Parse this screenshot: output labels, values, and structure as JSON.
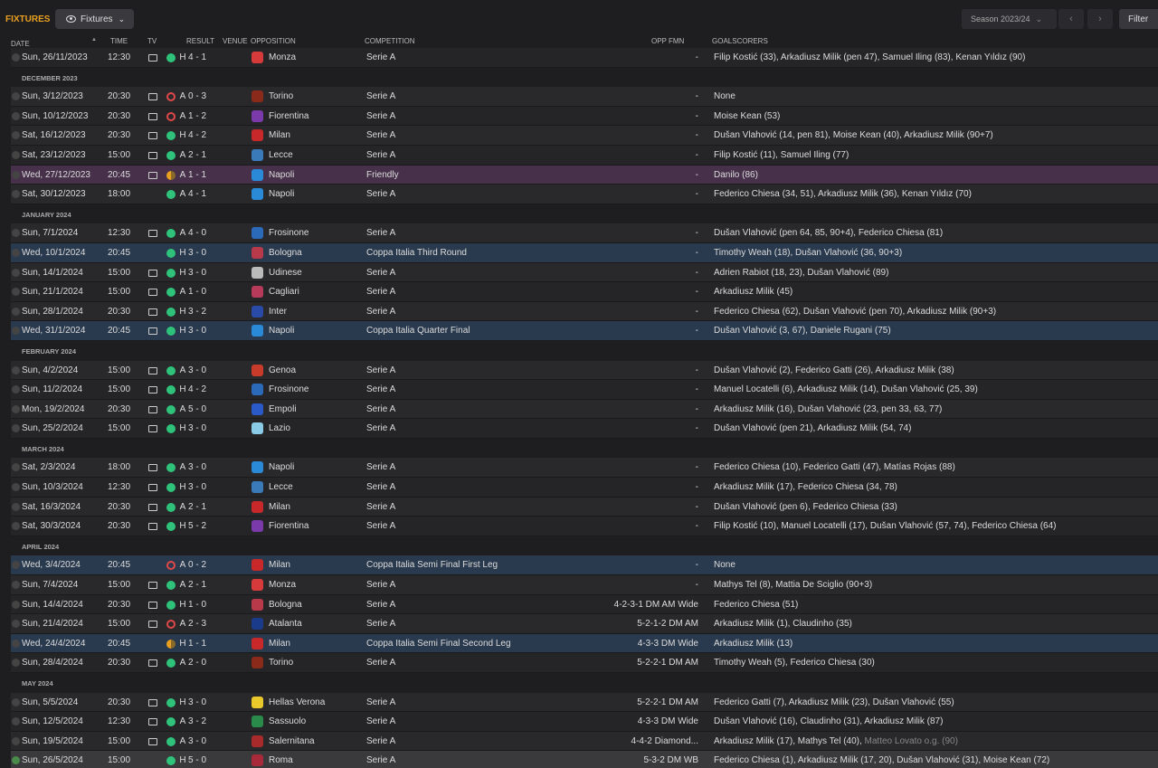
{
  "header": {
    "title": "FIXTURES",
    "view_label": "Fixtures",
    "season": "Season 2023/24",
    "filter": "Filter",
    "prev": "‹",
    "next": "›"
  },
  "columns": {
    "date": "DATE",
    "time": "TIME",
    "tv": "TV",
    "result": "RESULT",
    "venue": "VENUE",
    "opposition": "OPPOSITION",
    "competition": "COMPETITION",
    "opp_fmn": "OPP FMN",
    "goalscorers": "GOALSCORERS"
  },
  "rows": [
    {
      "type": "match",
      "date": "Sun, 26/11/2023",
      "time": "12:30",
      "tv": true,
      "outcome": "win",
      "score": "4 - 1",
      "venue": "H",
      "opp": "Monza",
      "crest": "#d63a3a",
      "comp": "Serie A",
      "fmn": "-",
      "goals": "Filip Kostić (33), Arkadiusz Milik (pen 47), Samuel Iling (83), Kenan Yıldız (90)",
      "style": "alt"
    },
    {
      "type": "section",
      "label": "DECEMBER 2023"
    },
    {
      "type": "match",
      "date": "Sun, 3/12/2023",
      "time": "20:30",
      "tv": true,
      "outcome": "loss",
      "score": "0 - 3",
      "venue": "A",
      "opp": "Torino",
      "crest": "#8a2a1a",
      "comp": "Serie A",
      "fmn": "-",
      "goals": "None",
      "style": ""
    },
    {
      "type": "match",
      "date": "Sun, 10/12/2023",
      "time": "20:30",
      "tv": true,
      "outcome": "loss",
      "score": "1 - 2",
      "venue": "A",
      "opp": "Fiorentina",
      "crest": "#7a3aaa",
      "comp": "Serie A",
      "fmn": "-",
      "goals": "Moise Kean (53)",
      "style": "alt"
    },
    {
      "type": "match",
      "date": "Sat, 16/12/2023",
      "time": "20:30",
      "tv": true,
      "outcome": "win",
      "score": "4 - 2",
      "venue": "H",
      "opp": "Milan",
      "crest": "#c8282a",
      "comp": "Serie A",
      "fmn": "-",
      "goals": "Dušan Vlahović (14, pen 81), Moise Kean (40), Arkadiusz Milik (90+7)",
      "style": ""
    },
    {
      "type": "match",
      "date": "Sat, 23/12/2023",
      "time": "15:00",
      "tv": true,
      "outcome": "win",
      "score": "2 - 1",
      "venue": "A",
      "opp": "Lecce",
      "crest": "#3a7ab8",
      "comp": "Serie A",
      "fmn": "-",
      "goals": "Filip Kostić (11), Samuel Iling (77)",
      "style": "alt"
    },
    {
      "type": "match",
      "date": "Wed, 27/12/2023",
      "time": "20:45",
      "tv": true,
      "outcome": "draw",
      "score": "1 - 1",
      "venue": "A",
      "opp": "Napoli",
      "crest": "#2a8ad8",
      "comp": "Friendly",
      "fmn": "-",
      "goals": "Danilo (86)",
      "style": "friendly"
    },
    {
      "type": "match",
      "date": "Sat, 30/12/2023",
      "time": "18:00",
      "tv": false,
      "outcome": "win",
      "score": "4 - 1",
      "venue": "A",
      "opp": "Napoli",
      "crest": "#2a8ad8",
      "comp": "Serie A",
      "fmn": "-",
      "goals": "Federico Chiesa (34, 51), Arkadiusz Milik (36), Kenan Yıldız (70)",
      "style": ""
    },
    {
      "type": "section",
      "label": "JANUARY 2024"
    },
    {
      "type": "match",
      "date": "Sun, 7/1/2024",
      "time": "12:30",
      "tv": true,
      "outcome": "win",
      "score": "4 - 0",
      "venue": "A",
      "opp": "Frosinone",
      "crest": "#2a6ab8",
      "comp": "Serie A",
      "fmn": "-",
      "goals": "Dušan Vlahović (pen 64, 85, 90+4), Federico Chiesa (81)",
      "style": ""
    },
    {
      "type": "match",
      "date": "Wed, 10/1/2024",
      "time": "20:45",
      "tv": false,
      "outcome": "win",
      "score": "3 - 0",
      "venue": "H",
      "opp": "Bologna",
      "crest": "#b83a4a",
      "comp": "Coppa Italia Third Round",
      "fmn": "-",
      "goals": "Timothy Weah (18), Dušan Vlahović (36, 90+3)",
      "style": "cup"
    },
    {
      "type": "match",
      "date": "Sun, 14/1/2024",
      "time": "15:00",
      "tv": true,
      "outcome": "win",
      "score": "3 - 0",
      "venue": "H",
      "opp": "Udinese",
      "crest": "#bbbbbb",
      "comp": "Serie A",
      "fmn": "-",
      "goals": "Adrien Rabiot (18, 23), Dušan Vlahović (89)",
      "style": ""
    },
    {
      "type": "match",
      "date": "Sun, 21/1/2024",
      "time": "15:00",
      "tv": true,
      "outcome": "win",
      "score": "1 - 0",
      "venue": "A",
      "opp": "Cagliari",
      "crest": "#b83a5a",
      "comp": "Serie A",
      "fmn": "-",
      "goals": "Arkadiusz Milik (45)",
      "style": "alt"
    },
    {
      "type": "match",
      "date": "Sun, 28/1/2024",
      "time": "20:30",
      "tv": true,
      "outcome": "win",
      "score": "3 - 2",
      "venue": "H",
      "opp": "Inter",
      "crest": "#2a4aa8",
      "comp": "Serie A",
      "fmn": "-",
      "goals": "Federico Chiesa (62), Dušan Vlahović (pen 70), Arkadiusz Milik (90+3)",
      "style": ""
    },
    {
      "type": "match",
      "date": "Wed, 31/1/2024",
      "time": "20:45",
      "tv": true,
      "outcome": "win",
      "score": "3 - 0",
      "venue": "H",
      "opp": "Napoli",
      "crest": "#2a8ad8",
      "comp": "Coppa Italia Quarter Final",
      "fmn": "-",
      "goals": "Dušan Vlahović (3, 67), Daniele Rugani (75)",
      "style": "cup"
    },
    {
      "type": "section",
      "label": "FEBRUARY 2024"
    },
    {
      "type": "match",
      "date": "Sun, 4/2/2024",
      "time": "15:00",
      "tv": true,
      "outcome": "win",
      "score": "3 - 0",
      "venue": "A",
      "opp": "Genoa",
      "crest": "#c83a2a",
      "comp": "Serie A",
      "fmn": "-",
      "goals": "Dušan Vlahović (2), Federico Gatti (26), Arkadiusz Milik (38)",
      "style": ""
    },
    {
      "type": "match",
      "date": "Sun, 11/2/2024",
      "time": "15:00",
      "tv": true,
      "outcome": "win",
      "score": "4 - 2",
      "venue": "H",
      "opp": "Frosinone",
      "crest": "#2a6ab8",
      "comp": "Serie A",
      "fmn": "-",
      "goals": "Manuel Locatelli (6), Arkadiusz Milik (14), Dušan Vlahović (25, 39)",
      "style": "alt"
    },
    {
      "type": "match",
      "date": "Mon, 19/2/2024",
      "time": "20:30",
      "tv": true,
      "outcome": "win",
      "score": "5 - 0",
      "venue": "A",
      "opp": "Empoli",
      "crest": "#2a5ac8",
      "comp": "Serie A",
      "fmn": "-",
      "goals": "Arkadiusz Milik (16), Dušan Vlahović (23, pen 33, 63, 77)",
      "style": ""
    },
    {
      "type": "match",
      "date": "Sun, 25/2/2024",
      "time": "15:00",
      "tv": true,
      "outcome": "win",
      "score": "3 - 0",
      "venue": "H",
      "opp": "Lazio",
      "crest": "#8acbe8",
      "comp": "Serie A",
      "fmn": "-",
      "goals": "Dušan Vlahović (pen 21), Arkadiusz Milik (54, 74)",
      "style": "alt"
    },
    {
      "type": "section",
      "label": "MARCH 2024"
    },
    {
      "type": "match",
      "date": "Sat, 2/3/2024",
      "time": "18:00",
      "tv": true,
      "outcome": "win",
      "score": "3 - 0",
      "venue": "A",
      "opp": "Napoli",
      "crest": "#2a8ad8",
      "comp": "Serie A",
      "fmn": "-",
      "goals": "Federico Chiesa (10), Federico Gatti (47), Matías Rojas (88)",
      "style": ""
    },
    {
      "type": "match",
      "date": "Sun, 10/3/2024",
      "time": "12:30",
      "tv": true,
      "outcome": "win",
      "score": "3 - 0",
      "venue": "H",
      "opp": "Lecce",
      "crest": "#3a7ab8",
      "comp": "Serie A",
      "fmn": "-",
      "goals": "Arkadiusz Milik (17), Federico Chiesa (34, 78)",
      "style": "alt"
    },
    {
      "type": "match",
      "date": "Sat, 16/3/2024",
      "time": "20:30",
      "tv": true,
      "outcome": "win",
      "score": "2 - 1",
      "venue": "A",
      "opp": "Milan",
      "crest": "#c8282a",
      "comp": "Serie A",
      "fmn": "-",
      "goals": "Dušan Vlahović (pen 6), Federico Chiesa (33)",
      "style": ""
    },
    {
      "type": "match",
      "date": "Sat, 30/3/2024",
      "time": "20:30",
      "tv": true,
      "outcome": "win",
      "score": "5 - 2",
      "venue": "H",
      "opp": "Fiorentina",
      "crest": "#7a3aaa",
      "comp": "Serie A",
      "fmn": "-",
      "goals": "Filip Kostić (10), Manuel Locatelli (17), Dušan Vlahović (57, 74), Federico Chiesa (64)",
      "style": "alt"
    },
    {
      "type": "section",
      "label": "APRIL 2024"
    },
    {
      "type": "match",
      "date": "Wed, 3/4/2024",
      "time": "20:45",
      "tv": false,
      "outcome": "loss",
      "score": "0 - 2",
      "venue": "A",
      "opp": "Milan",
      "crest": "#c8282a",
      "comp": "Coppa Italia Semi Final First Leg",
      "fmn": "-",
      "goals": "None",
      "style": "cup"
    },
    {
      "type": "match",
      "date": "Sun, 7/4/2024",
      "time": "15:00",
      "tv": true,
      "outcome": "win",
      "score": "2 - 1",
      "venue": "A",
      "opp": "Monza",
      "crest": "#d63a3a",
      "comp": "Serie A",
      "fmn": "-",
      "goals": "Mathys Tel (8), Mattia De Sciglio (90+3)",
      "style": ""
    },
    {
      "type": "match",
      "date": "Sun, 14/4/2024",
      "time": "20:30",
      "tv": true,
      "outcome": "win",
      "score": "1 - 0",
      "venue": "H",
      "opp": "Bologna",
      "crest": "#b83a4a",
      "comp": "Serie A",
      "fmn": "4-2-3-1 DM AM Wide",
      "goals": "Federico Chiesa (51)",
      "style": "alt"
    },
    {
      "type": "match",
      "date": "Sun, 21/4/2024",
      "time": "15:00",
      "tv": true,
      "outcome": "loss",
      "score": "2 - 3",
      "venue": "A",
      "opp": "Atalanta",
      "crest": "#1a3a8a",
      "comp": "Serie A",
      "fmn": "5-2-1-2 DM AM",
      "goals": "Arkadiusz Milik (1), Claudinho (35)",
      "style": ""
    },
    {
      "type": "match",
      "date": "Wed, 24/4/2024",
      "time": "20:45",
      "tv": false,
      "outcome": "draw",
      "score": "1 - 1",
      "venue": "H",
      "opp": "Milan",
      "crest": "#c8282a",
      "comp": "Coppa Italia Semi Final Second Leg",
      "fmn": "4-3-3 DM Wide",
      "goals": "Arkadiusz Milik (13)",
      "style": "cup"
    },
    {
      "type": "match",
      "date": "Sun, 28/4/2024",
      "time": "20:30",
      "tv": true,
      "outcome": "win",
      "score": "2 - 0",
      "venue": "A",
      "opp": "Torino",
      "crest": "#8a2a1a",
      "comp": "Serie A",
      "fmn": "5-2-2-1 DM AM",
      "goals": "Timothy Weah (5), Federico Chiesa (30)",
      "style": "alt"
    },
    {
      "type": "section",
      "label": "MAY 2024"
    },
    {
      "type": "match",
      "date": "Sun, 5/5/2024",
      "time": "20:30",
      "tv": true,
      "outcome": "win",
      "score": "3 - 0",
      "venue": "H",
      "opp": "Hellas Verona",
      "crest": "#e8c82a",
      "comp": "Serie A",
      "fmn": "5-2-2-1 DM AM",
      "goals": "Federico Gatti (7), Arkadiusz Milik (23), Dušan Vlahović (55)",
      "style": ""
    },
    {
      "type": "match",
      "date": "Sun, 12/5/2024",
      "time": "12:30",
      "tv": true,
      "outcome": "win",
      "score": "3 - 2",
      "venue": "A",
      "opp": "Sassuolo",
      "crest": "#2a8a4a",
      "comp": "Serie A",
      "fmn": "4-3-3 DM Wide",
      "goals": "Dušan Vlahović (16), Claudinho (31), Arkadiusz Milik (87)",
      "style": "alt"
    },
    {
      "type": "match",
      "date": "Sun, 19/5/2024",
      "time": "15:00",
      "tv": true,
      "outcome": "win",
      "score": "3 - 0",
      "venue": "A",
      "opp": "Salernitana",
      "crest": "#a82a2a",
      "comp": "Serie A",
      "fmn": "4-4-2 Diamond...",
      "goals": "Arkadiusz Milik (17), Mathys Tel (40), ",
      "og": "Matteo Lovato o.g. (90)",
      "style": ""
    },
    {
      "type": "match",
      "date": "Sun, 26/5/2024",
      "time": "15:00",
      "tv": false,
      "outcome": "win",
      "score": "5 - 0",
      "venue": "H",
      "opp": "Roma",
      "crest": "#a82a3a",
      "comp": "Serie A",
      "fmn": "5-3-2 DM WB",
      "goals": "Federico Chiesa (1), Arkadiusz Milik (17, 20), Dušan Vlahović (31), Moise Kean (72)",
      "style": "last",
      "checked": true
    }
  ]
}
